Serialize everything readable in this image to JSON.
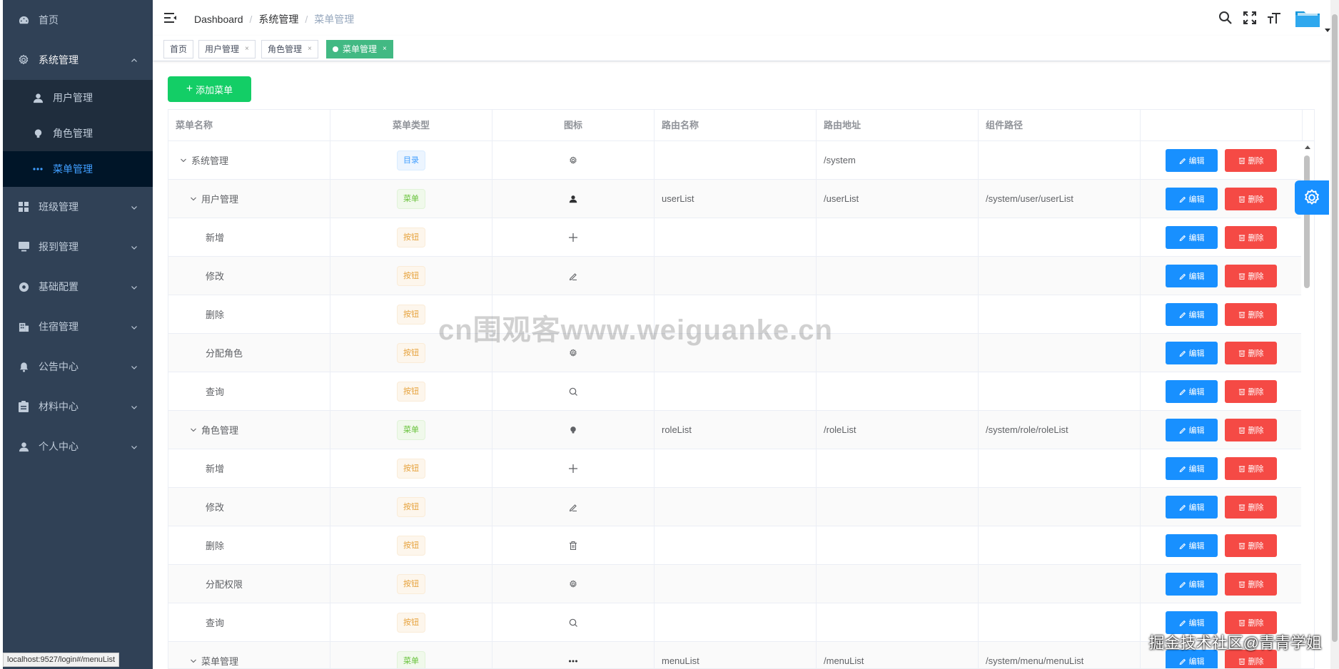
{
  "sidebar": {
    "items": [
      {
        "label": "首页",
        "icon": "dashboard-icon"
      },
      {
        "label": "系统管理",
        "icon": "gear-icon",
        "expanded": true,
        "children": [
          {
            "label": "用户管理",
            "icon": "user-icon"
          },
          {
            "label": "角色管理",
            "icon": "peoples-icon"
          },
          {
            "label": "菜单管理",
            "icon": "more-icon",
            "active": true
          }
        ]
      },
      {
        "label": "班级管理",
        "icon": "grid-icon"
      },
      {
        "label": "报到管理",
        "icon": "monitor-icon"
      },
      {
        "label": "基础配置",
        "icon": "circle-icon"
      },
      {
        "label": "住宿管理",
        "icon": "building-icon"
      },
      {
        "label": "公告中心",
        "icon": "bell-icon"
      },
      {
        "label": "材料中心",
        "icon": "clipboard-icon"
      },
      {
        "label": "个人中心",
        "icon": "user-icon"
      }
    ]
  },
  "breadcrumb": [
    "Dashboard",
    "系统管理",
    "菜单管理"
  ],
  "tags": [
    {
      "label": "首页",
      "closable": false
    },
    {
      "label": "用户管理",
      "closable": true
    },
    {
      "label": "角色管理",
      "closable": true
    },
    {
      "label": "菜单管理",
      "closable": true,
      "active": true
    }
  ],
  "tag_close_glyph": "×",
  "add_button": "添加菜单",
  "table": {
    "headers": [
      "菜单名称",
      "菜单类型",
      "图标",
      "路由名称",
      "路由地址",
      "组件路径",
      ""
    ],
    "edit_label": "编辑",
    "delete_label": "删除",
    "rows": [
      {
        "name": "系统管理",
        "level": 0,
        "expandable": true,
        "type": "目录",
        "type_kind": "dir",
        "icon": "gear-icon",
        "route_name": "",
        "route_path": "/system",
        "component": ""
      },
      {
        "name": "用户管理",
        "level": 1,
        "expandable": true,
        "type": "菜单",
        "type_kind": "menu",
        "icon": "user-icon",
        "route_name": "userList",
        "route_path": "/userList",
        "component": "/system/user/userList"
      },
      {
        "name": "新增",
        "level": 2,
        "expandable": false,
        "type": "按钮",
        "type_kind": "btn",
        "icon": "plus-icon",
        "route_name": "",
        "route_path": "",
        "component": ""
      },
      {
        "name": "修改",
        "level": 2,
        "expandable": false,
        "type": "按钮",
        "type_kind": "btn",
        "icon": "edit-icon",
        "route_name": "",
        "route_path": "",
        "component": ""
      },
      {
        "name": "删除",
        "level": 2,
        "expandable": false,
        "type": "按钮",
        "type_kind": "btn",
        "icon": "",
        "route_name": "",
        "route_path": "",
        "component": ""
      },
      {
        "name": "分配角色",
        "level": 2,
        "expandable": false,
        "type": "按钮",
        "type_kind": "btn",
        "icon": "gear-icon",
        "route_name": "",
        "route_path": "",
        "component": ""
      },
      {
        "name": "查询",
        "level": 2,
        "expandable": false,
        "type": "按钮",
        "type_kind": "btn",
        "icon": "search-icon",
        "route_name": "",
        "route_path": "",
        "component": ""
      },
      {
        "name": "角色管理",
        "level": 1,
        "expandable": true,
        "type": "菜单",
        "type_kind": "menu",
        "icon": "peoples-icon",
        "route_name": "roleList",
        "route_path": "/roleList",
        "component": "/system/role/roleList"
      },
      {
        "name": "新增",
        "level": 2,
        "expandable": false,
        "type": "按钮",
        "type_kind": "btn",
        "icon": "plus-icon",
        "route_name": "",
        "route_path": "",
        "component": ""
      },
      {
        "name": "修改",
        "level": 2,
        "expandable": false,
        "type": "按钮",
        "type_kind": "btn",
        "icon": "edit-icon",
        "route_name": "",
        "route_path": "",
        "component": ""
      },
      {
        "name": "删除",
        "level": 2,
        "expandable": false,
        "type": "按钮",
        "type_kind": "btn",
        "icon": "trash-icon",
        "route_name": "",
        "route_path": "",
        "component": ""
      },
      {
        "name": "分配权限",
        "level": 2,
        "expandable": false,
        "type": "按钮",
        "type_kind": "btn",
        "icon": "gear-icon",
        "route_name": "",
        "route_path": "",
        "component": ""
      },
      {
        "name": "查询",
        "level": 2,
        "expandable": false,
        "type": "按钮",
        "type_kind": "btn",
        "icon": "search-icon",
        "route_name": "",
        "route_path": "",
        "component": ""
      },
      {
        "name": "菜单管理",
        "level": 1,
        "expandable": true,
        "type": "菜单",
        "type_kind": "menu",
        "icon": "more-icon",
        "route_name": "menuList",
        "route_path": "/menuList",
        "component": "/system/menu/menuList"
      }
    ]
  },
  "watermark": "cn围观客www.weiguanke.cn",
  "status_url": "localhost:9527/login#/menuList",
  "footer_mark": "掘金技术社区@青青学姐",
  "colors": {
    "sidebar_bg": "#304156",
    "submenu_bg": "#1f2d3d",
    "active_text": "#409eff",
    "add_button": "#13ce66",
    "edit_button": "#1890ff",
    "delete_button": "#f54a45",
    "active_tag": "#42b983"
  }
}
